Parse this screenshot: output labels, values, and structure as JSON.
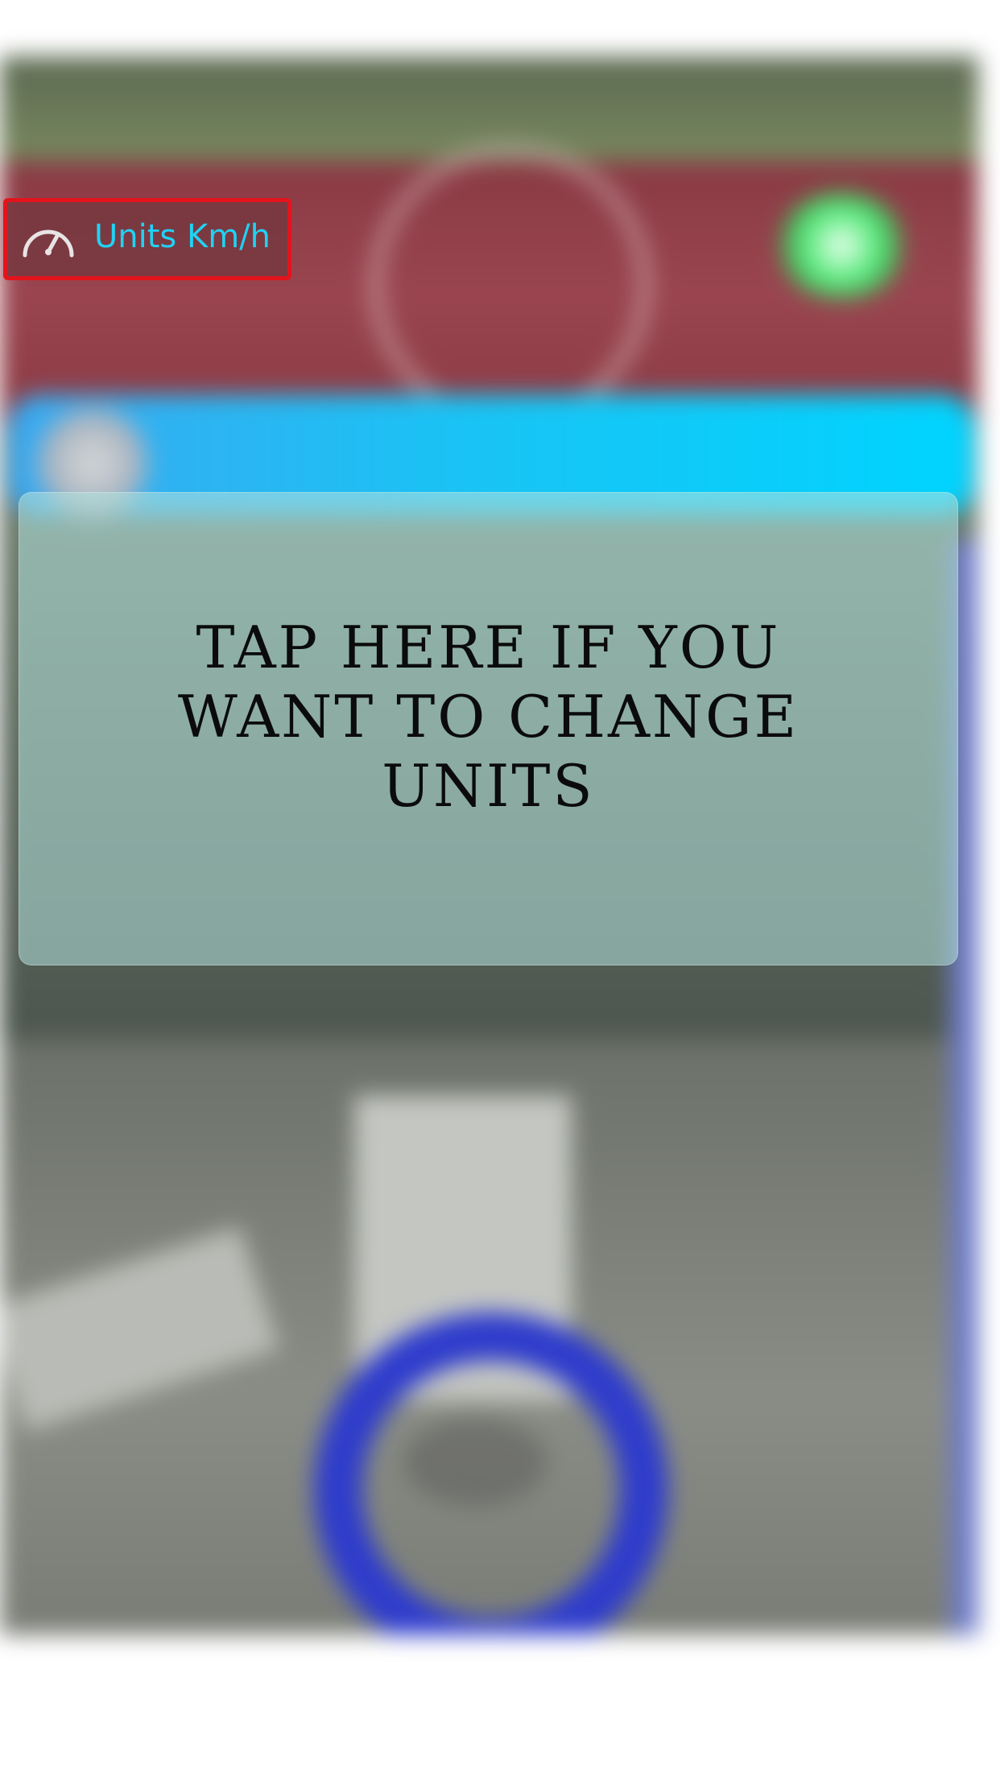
{
  "units_button": {
    "icon": "speedometer-icon",
    "label": "Units Km/h",
    "label_color": "#20d2f4",
    "highlight_color": "#e3141c"
  },
  "tutorial_tip": {
    "text": "TAP HERE IF YOU WANT TO CHANGE UNITS"
  },
  "colors": {
    "track": "#8a3a44",
    "blue_bar": "#00d4ff",
    "progress_ring": "#2e3ccc",
    "status_dot": "#3cc85c"
  }
}
